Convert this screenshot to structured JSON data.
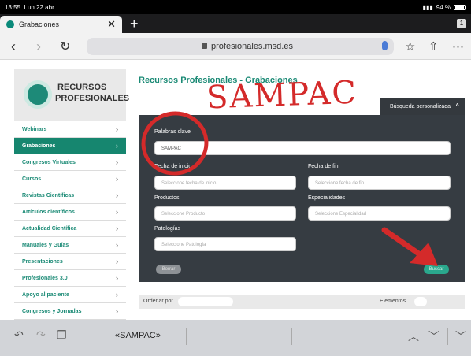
{
  "status": {
    "time": "13:55",
    "date": "Lun 22 abr",
    "battery": "94 %"
  },
  "tab": {
    "title": "Grabaciones",
    "close": "✕",
    "new": "+",
    "count": "1"
  },
  "address": {
    "url": "profesionales.msd.es"
  },
  "logo": {
    "line1": "RECURSOS",
    "line2": "PROFESIONALES"
  },
  "sidebar": {
    "items": [
      {
        "label": "Webinars"
      },
      {
        "label": "Grabaciones"
      },
      {
        "label": "Congresos Virtuales"
      },
      {
        "label": "Cursos"
      },
      {
        "label": "Revistas Científicas"
      },
      {
        "label": "Artículos científicos"
      },
      {
        "label": "Actualidad Científica"
      },
      {
        "label": "Manuales y Guías"
      },
      {
        "label": "Presentaciones"
      },
      {
        "label": "Profesionales 3.0"
      },
      {
        "label": "Apoyo al paciente"
      },
      {
        "label": "Congresos y Jornadas"
      }
    ],
    "chevron": "›"
  },
  "heading": "Recursos Profesionales - Grabaciones",
  "annotation": "SAMPAC",
  "adv_search": {
    "label": "Búsqueda personalizada",
    "chevron": "^"
  },
  "form": {
    "keywords_label": "Palabras clave",
    "keywords_value": "SAMPAC",
    "start_label": "Fecha de inicio",
    "start_placeholder": "Seleccione fecha de inicio",
    "end_label": "Fecha de fin",
    "end_placeholder": "Seleccione fecha de fin",
    "products_label": "Productos",
    "products_placeholder": "Seleccione Producto",
    "specialties_label": "Especialidades",
    "specialties_placeholder": "Seleccione Especialidad",
    "pathologies_label": "Patologías",
    "pathologies_placeholder": "Seleccione Patología",
    "clear_label": "Borrar",
    "search_label": "Buscar"
  },
  "sortbar": {
    "order_label": "Ordenar por",
    "elements_label": "Elementos"
  },
  "keyboard": {
    "suggestion": "«SAMPAC»"
  },
  "colors": {
    "brand": "#16866f",
    "annotation": "#d42a2a",
    "panel": "#363c42"
  }
}
